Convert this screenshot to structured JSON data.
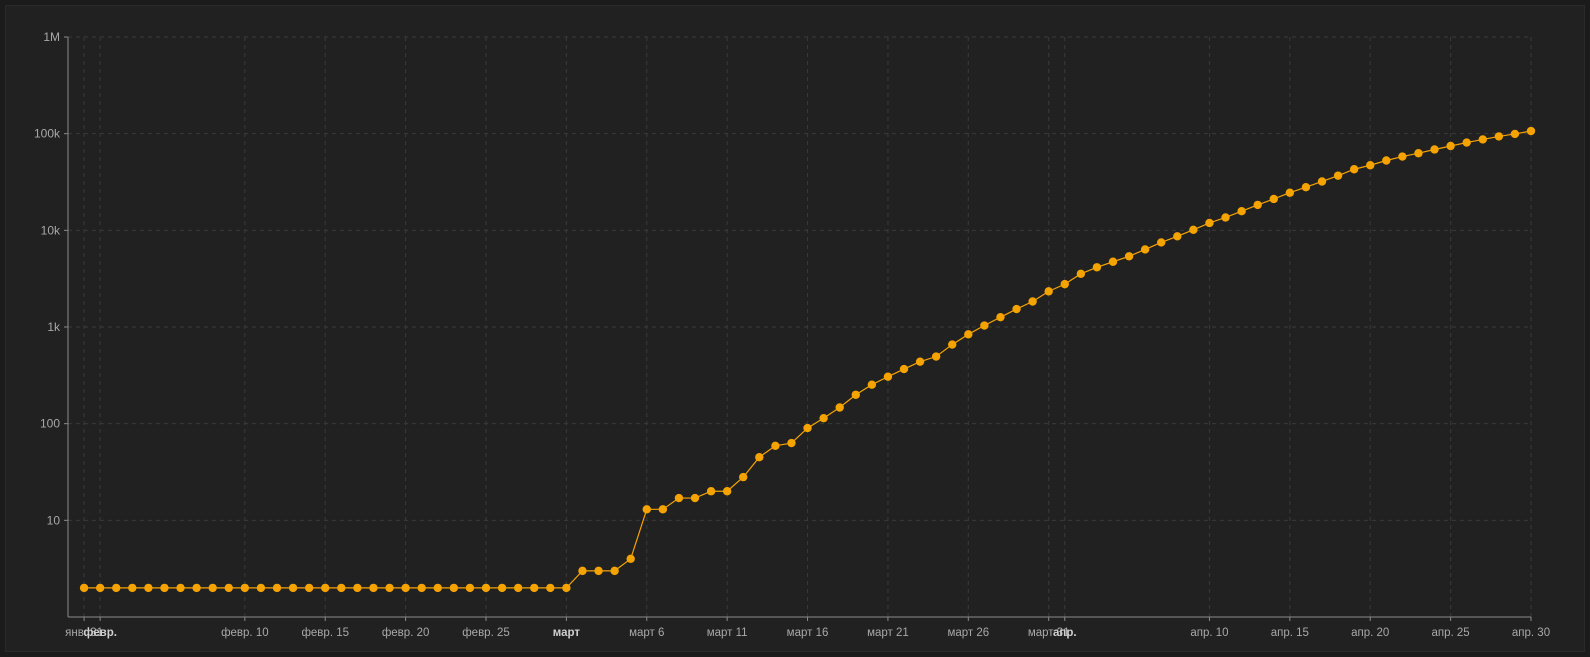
{
  "chart_data": {
    "type": "line",
    "title": "",
    "xlabel": "",
    "ylabel": "",
    "y_scale": "log",
    "ylim": [
      1,
      1000000
    ],
    "y_ticks": [
      {
        "value": 10,
        "label": "10"
      },
      {
        "value": 100,
        "label": "100"
      },
      {
        "value": 1000,
        "label": "1k"
      },
      {
        "value": 10000,
        "label": "10k"
      },
      {
        "value": 100000,
        "label": "100k"
      },
      {
        "value": 1000000,
        "label": "1M"
      }
    ],
    "xlim": [
      "2020-01-30",
      "2020-04-30"
    ],
    "x_ticks": [
      {
        "date": "2020-01-31",
        "label": "янв. 31",
        "major": false
      },
      {
        "date": "2020-02-01",
        "label": "февр.",
        "major": true
      },
      {
        "date": "2020-02-10",
        "label": "февр. 10",
        "major": false
      },
      {
        "date": "2020-02-15",
        "label": "февр. 15",
        "major": false
      },
      {
        "date": "2020-02-20",
        "label": "февр. 20",
        "major": false
      },
      {
        "date": "2020-02-25",
        "label": "февр. 25",
        "major": false
      },
      {
        "date": "2020-03-01",
        "label": "март",
        "major": true
      },
      {
        "date": "2020-03-06",
        "label": "март 6",
        "major": false
      },
      {
        "date": "2020-03-11",
        "label": "март 11",
        "major": false
      },
      {
        "date": "2020-03-16",
        "label": "март 16",
        "major": false
      },
      {
        "date": "2020-03-21",
        "label": "март 21",
        "major": false
      },
      {
        "date": "2020-03-26",
        "label": "март 26",
        "major": false
      },
      {
        "date": "2020-03-31",
        "label": "март 31",
        "major": false
      },
      {
        "date": "2020-04-01",
        "label": "апр.",
        "major": true
      },
      {
        "date": "2020-04-10",
        "label": "апр. 10",
        "major": false
      },
      {
        "date": "2020-04-15",
        "label": "апр. 15",
        "major": false
      },
      {
        "date": "2020-04-20",
        "label": "апр. 20",
        "major": false
      },
      {
        "date": "2020-04-25",
        "label": "апр. 25",
        "major": false
      },
      {
        "date": "2020-04-30",
        "label": "апр. 30",
        "major": false
      }
    ],
    "grid": true,
    "legend": "none",
    "series": [
      {
        "color": "#f5a300",
        "x": [
          "2020-01-31",
          "2020-02-01",
          "2020-02-02",
          "2020-02-03",
          "2020-02-04",
          "2020-02-05",
          "2020-02-06",
          "2020-02-07",
          "2020-02-08",
          "2020-02-09",
          "2020-02-10",
          "2020-02-11",
          "2020-02-12",
          "2020-02-13",
          "2020-02-14",
          "2020-02-15",
          "2020-02-16",
          "2020-02-17",
          "2020-02-18",
          "2020-02-19",
          "2020-02-20",
          "2020-02-21",
          "2020-02-22",
          "2020-02-23",
          "2020-02-24",
          "2020-02-25",
          "2020-02-26",
          "2020-02-27",
          "2020-02-28",
          "2020-02-29",
          "2020-03-01",
          "2020-03-02",
          "2020-03-03",
          "2020-03-04",
          "2020-03-05",
          "2020-03-06",
          "2020-03-07",
          "2020-03-08",
          "2020-03-09",
          "2020-03-10",
          "2020-03-11",
          "2020-03-12",
          "2020-03-13",
          "2020-03-14",
          "2020-03-15",
          "2020-03-16",
          "2020-03-17",
          "2020-03-18",
          "2020-03-19",
          "2020-03-20",
          "2020-03-21",
          "2020-03-22",
          "2020-03-23",
          "2020-03-24",
          "2020-03-25",
          "2020-03-26",
          "2020-03-27",
          "2020-03-28",
          "2020-03-29",
          "2020-03-30",
          "2020-03-31",
          "2020-04-01",
          "2020-04-02",
          "2020-04-03",
          "2020-04-04",
          "2020-04-05",
          "2020-04-06",
          "2020-04-07",
          "2020-04-08",
          "2020-04-09",
          "2020-04-10",
          "2020-04-11",
          "2020-04-12",
          "2020-04-13",
          "2020-04-14",
          "2020-04-15",
          "2020-04-16",
          "2020-04-17",
          "2020-04-18",
          "2020-04-19",
          "2020-04-20",
          "2020-04-21",
          "2020-04-22",
          "2020-04-23",
          "2020-04-24",
          "2020-04-25",
          "2020-04-26",
          "2020-04-27",
          "2020-04-28",
          "2020-04-29",
          "2020-04-30"
        ],
        "values": [
          2,
          2,
          2,
          2,
          2,
          2,
          2,
          2,
          2,
          2,
          2,
          2,
          2,
          2,
          2,
          2,
          2,
          2,
          2,
          2,
          2,
          2,
          2,
          2,
          2,
          2,
          2,
          2,
          2,
          2,
          2,
          3,
          3,
          3,
          4,
          13,
          13,
          17,
          17,
          20,
          20,
          28,
          45,
          59,
          63,
          90,
          114,
          147,
          199,
          253,
          306,
          367,
          438,
          495,
          658,
          840,
          1036,
          1264,
          1534,
          1836,
          2337,
          2777,
          3548,
          4149,
          4731,
          5389,
          6343,
          7497,
          8672,
          10131,
          11917,
          13584,
          15770,
          18328,
          21102,
          24490,
          27938,
          32008,
          36793,
          42853,
          47121,
          52763,
          57999,
          62773,
          68622,
          74588,
          80949,
          87147,
          93558,
          99399,
          106498
        ]
      }
    ]
  }
}
